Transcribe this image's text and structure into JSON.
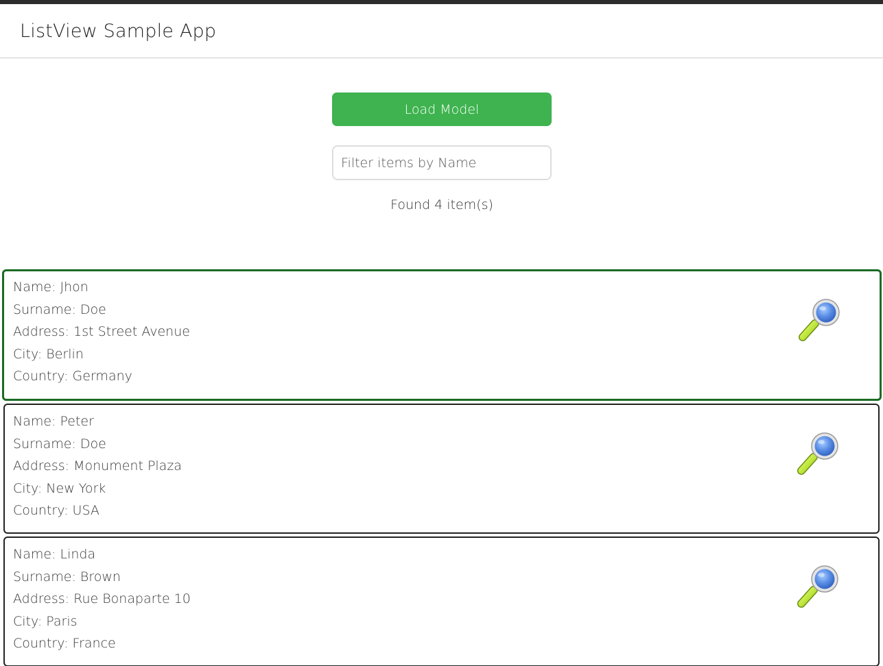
{
  "app": {
    "title": "ListView Sample App"
  },
  "controls": {
    "load_button_label": "Load Model",
    "filter_placeholder": "Filter items by Name",
    "filter_value": "",
    "found_text": "Found 4 item(s)"
  },
  "items": [
    {
      "name": "Name: Jhon",
      "surname": "Surname: Doe",
      "address": "Address: 1st Street Avenue",
      "city": "City: Berlin",
      "country": "Country: Germany",
      "icon": "magnifier-icon"
    },
    {
      "name": "Name: Peter",
      "surname": "Surname: Doe",
      "address": "Address: Monument Plaza",
      "city": "City: New York",
      "country": "Country: USA",
      "icon": "magnifier-icon"
    },
    {
      "name": "Name: Linda",
      "surname": "Surname: Brown",
      "address": "Address: Rue Bonaparte 10",
      "city": "City: Paris",
      "country": "Country: France",
      "icon": "magnifier-icon"
    }
  ],
  "colors": {
    "accent": "#3eb34f",
    "selected_border": "#1b6b24",
    "item_border": "#222222"
  }
}
